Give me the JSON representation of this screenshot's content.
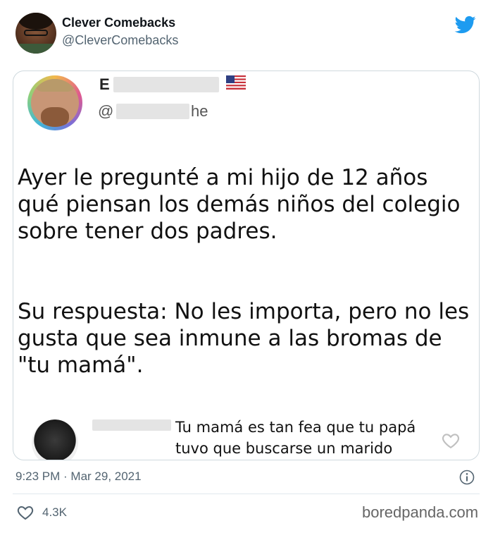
{
  "author": {
    "name": "Clever Comebacks",
    "handle": "@CleverComebacks"
  },
  "embedded_tweet": {
    "name_fragment": "E",
    "handle_start": "@",
    "handle_end": "he",
    "text_paragraphs": [
      "Ayer le pregunté a mi hijo de 12 años qué piensan los demás niños del colegio sobre tener dos padres.",
      "Su respuesta: No les importa, pero no les gusta que sea inmune a las bromas de \"tu mamá\"."
    ],
    "reply_text": "Tu mamá es tan fea que tu papá tuvo que buscarse un marido"
  },
  "footer": {
    "timestamp": "9:23 PM · Mar 29, 2021",
    "likes": "4.3K"
  },
  "watermark": "boredpanda.com",
  "icons": {
    "brand": "twitter-bird-icon",
    "flag": "us-flag-icon",
    "like": "heart-icon",
    "info": "info-icon"
  },
  "colors": {
    "twitter_blue": "#1d9bf0",
    "secondary_text": "#536471",
    "border": "#cfd9de"
  }
}
